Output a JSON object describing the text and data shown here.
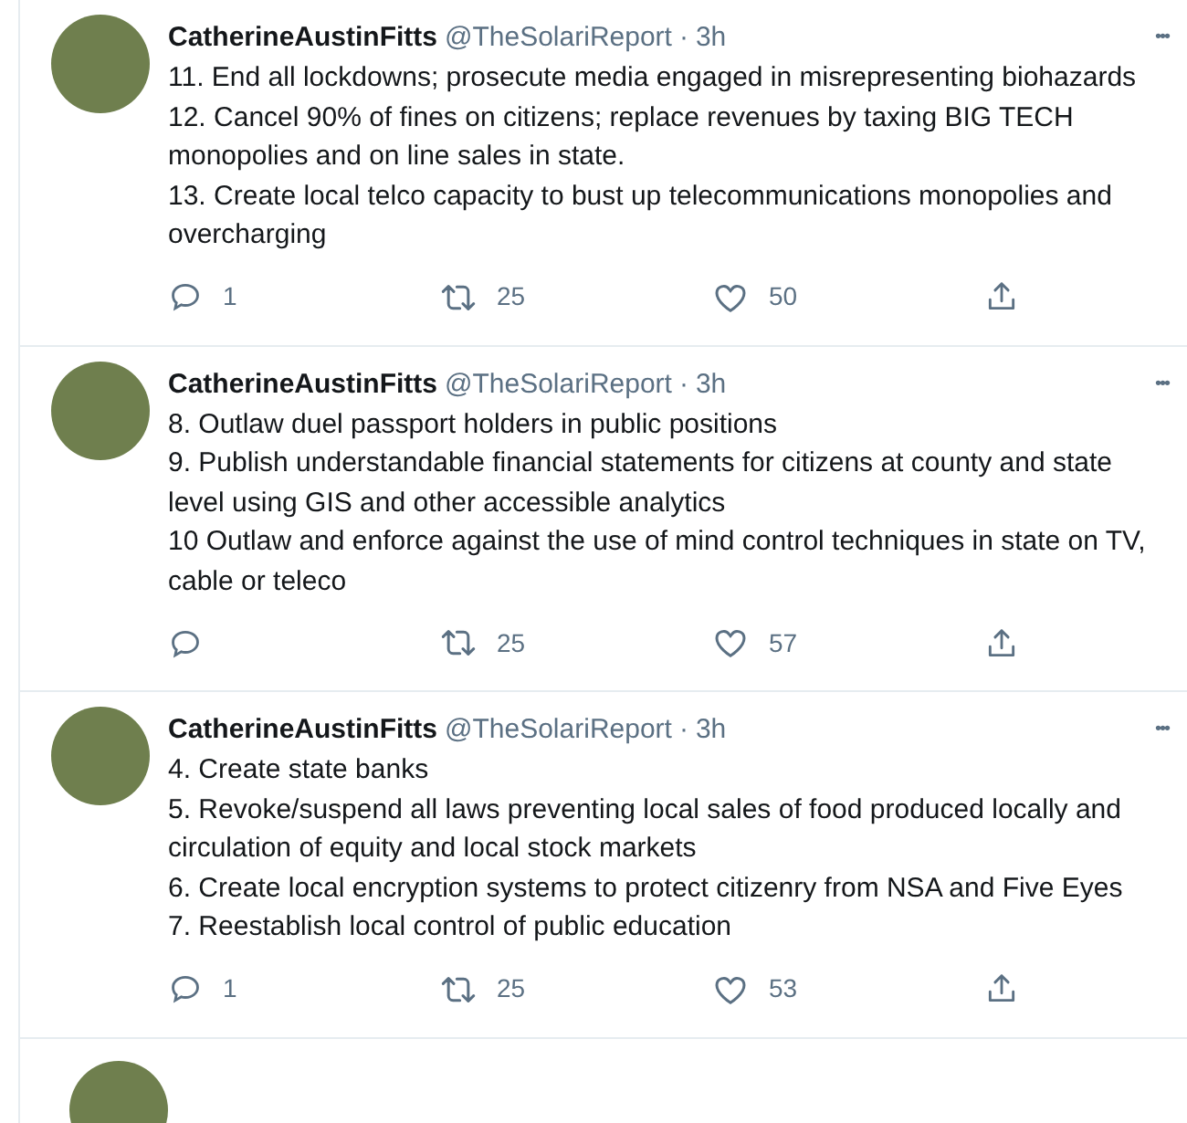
{
  "tweets": [
    {
      "name": "CatherineAustinFitts",
      "handle": "@TheSolariReport",
      "separator": "·",
      "time": "3h",
      "more": "•••",
      "points": [
        "11. End all lockdowns; prosecute media engaged in misrepresenting biohazards",
        "12. Cancel 90% of fines on citizens; replace revenues by taxing BIG TECH monopolies and on line sales in state.",
        "13. Create local telco capacity to bust up telecommunications monopolies and overcharging"
      ],
      "replies": "1",
      "retweets": "25",
      "likes": "50"
    },
    {
      "name": "CatherineAustinFitts",
      "handle": "@TheSolariReport",
      "separator": "·",
      "time": "3h",
      "more": "•••",
      "points": [
        "8. Outlaw duel passport holders in public positions",
        "9. Publish understandable financial statements for citizens at county and state level using GIS and other accessible analytics",
        "10 Outlaw and enforce against the use of mind control techniques in state on TV, cable or teleco"
      ],
      "retweets": "25",
      "likes": "57"
    },
    {
      "name": "CatherineAustinFitts",
      "handle": "@TheSolariReport",
      "separator": "·",
      "time": "3h",
      "more": "•••",
      "points": [
        "4. Create state banks",
        "5. Revoke/suspend all laws preventing local sales of food produced locally and circulation of equity and local stock markets",
        "6. Create local encryption systems to protect citizenry from NSA and Five Eyes",
        "7. Reestablish local control of public education"
      ],
      "replies": "1",
      "retweets": "25",
      "likes": "53"
    }
  ]
}
